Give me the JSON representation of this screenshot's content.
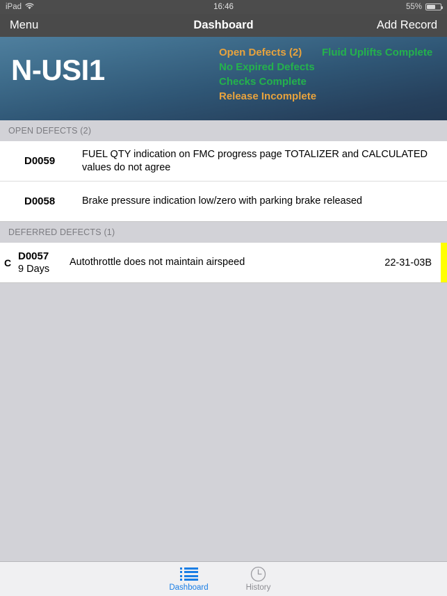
{
  "statusbar": {
    "device": "iPad",
    "wifi_icon": "wifi-icon",
    "time": "16:46",
    "battery_percent": "55%",
    "battery_level": 55
  },
  "navbar": {
    "menu_label": "Menu",
    "title": "Dashboard",
    "add_record_label": "Add Record"
  },
  "header": {
    "registration": "N-USI1",
    "statuses": [
      {
        "label": "Open Defects (2)",
        "state": "warn"
      },
      {
        "label": "No Expired Defects",
        "state": "ok"
      },
      {
        "label": "Checks Complete",
        "state": "ok"
      },
      {
        "label": "Release Incomplete",
        "state": "warn"
      }
    ],
    "statuses_right": [
      {
        "label": "Fluid Uplifts Complete",
        "state": "ok"
      }
    ],
    "colors": {
      "warn": "#e8a33d",
      "ok": "#24b24c",
      "gradient_top": "#4f7f9e",
      "gradient_bottom": "#233a54"
    }
  },
  "sections": [
    {
      "title": "OPEN DEFECTS (2)",
      "rows": [
        {
          "category": "",
          "id": "D0059",
          "sub": "",
          "description": "FUEL QTY indication on FMC progress page TOTALIZER and CALCULATED values do not agree",
          "ata": "",
          "flag_color": ""
        },
        {
          "category": "",
          "id": "D0058",
          "sub": "",
          "description": "Brake pressure indication low/zero with parking brake released",
          "ata": "",
          "flag_color": ""
        }
      ]
    },
    {
      "title": "DEFERRED DEFECTS (1)",
      "rows": [
        {
          "category": "C",
          "id": "D0057",
          "sub": "9 Days",
          "description": "Autothrottle does not maintain airspeed",
          "ata": "22-31-03B",
          "flag_color": "#ffff00"
        }
      ]
    }
  ],
  "tabbar": {
    "tabs": [
      {
        "label": "Dashboard",
        "icon": "list-icon",
        "active": true
      },
      {
        "label": "History",
        "icon": "clock-icon",
        "active": false
      }
    ],
    "active_color": "#1a7ee5",
    "inactive_color": "#8e8e93"
  }
}
